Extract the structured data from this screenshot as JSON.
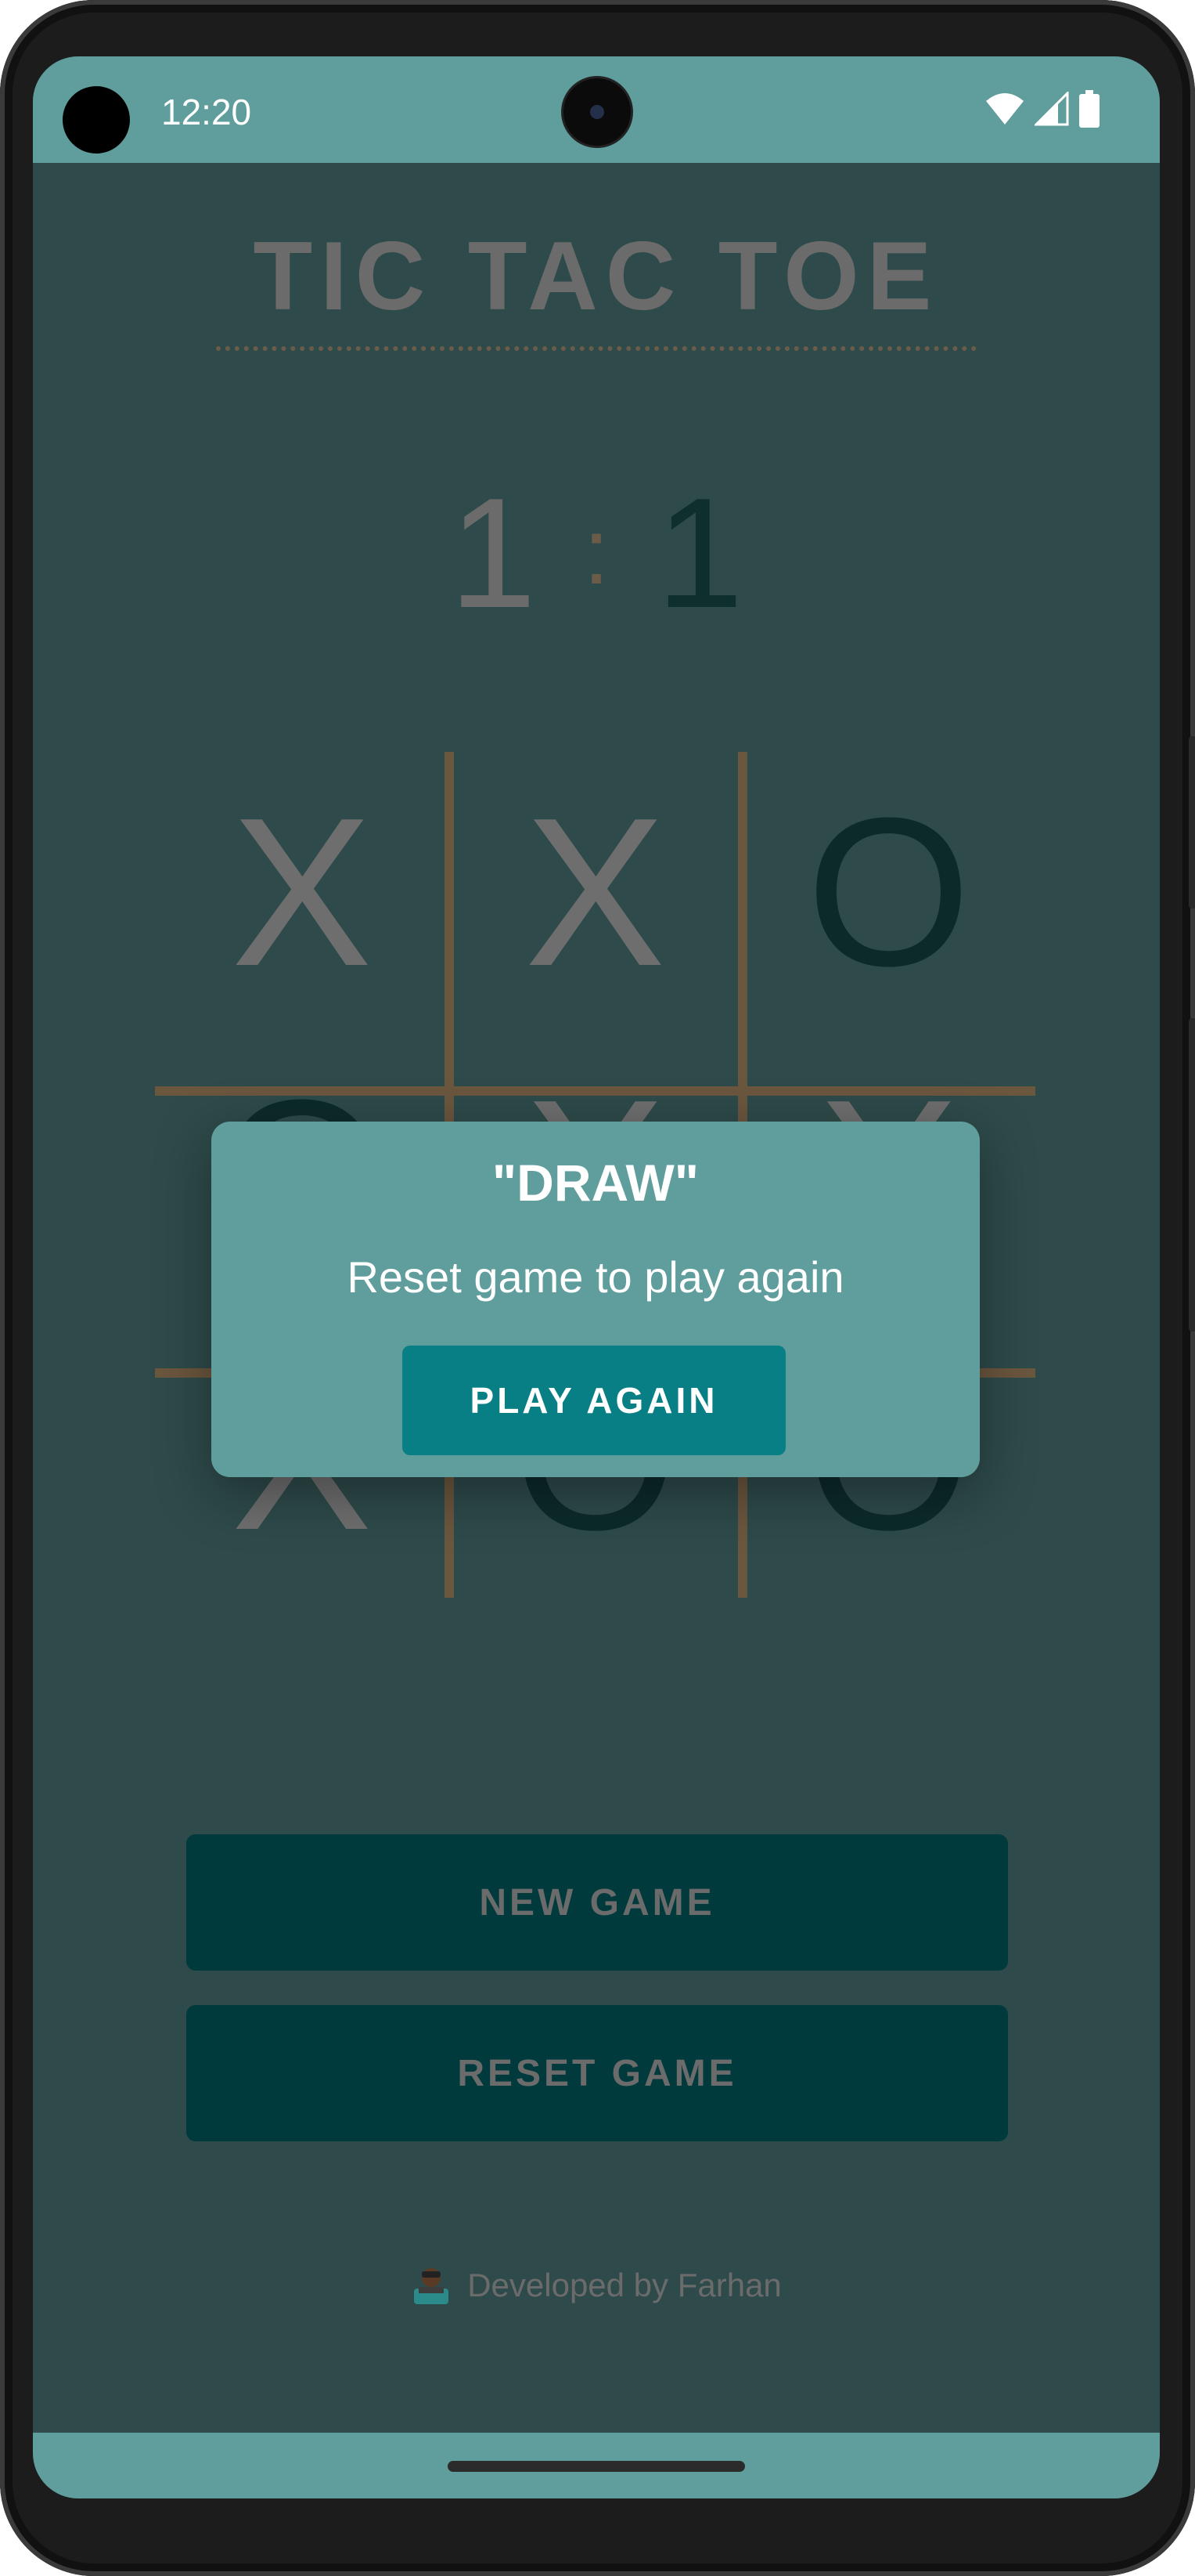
{
  "status_bar": {
    "time": "12:20",
    "icons": [
      "wifi-icon",
      "signal-icon",
      "battery-icon"
    ]
  },
  "app": {
    "title": "TIC TAC TOE",
    "score": {
      "player1": "1",
      "separator": ":",
      "player2": "1"
    },
    "board": [
      [
        "X",
        "X",
        "O"
      ],
      [
        "O",
        "X",
        "X"
      ],
      [
        "X",
        "O",
        "O"
      ]
    ],
    "buttons": {
      "new_game": "NEW GAME",
      "reset_game": "RESET GAME"
    },
    "footer": {
      "icon": "developer-emoji-icon",
      "text": "Developed by Farhan"
    }
  },
  "dialog": {
    "title": "\"DRAW\"",
    "message": "Reset game to play again",
    "button": "PLAY AGAIN"
  },
  "colors": {
    "bar": "#5f9e9c",
    "background": "#2e4a4a",
    "grid": "#6b563e",
    "x_mark": "#6e6e6e",
    "o_mark": "#0c2a2a",
    "dialog_button": "#087f84",
    "action_button": "#003a3c"
  }
}
